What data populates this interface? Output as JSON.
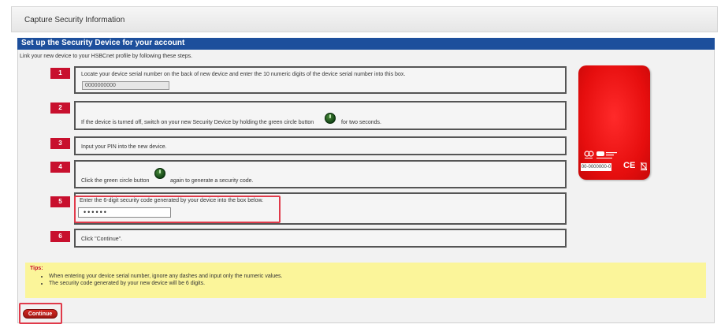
{
  "page": {
    "header_title": "Capture Security Information"
  },
  "section": {
    "title": "Set up the Security Device for your account",
    "intro": "Link your new device to your HSBCnet profile by following these steps."
  },
  "steps": [
    {
      "number": "1",
      "text": "Locate your device serial number on the back of new device and enter the 10 numeric digits of the device serial number into this box.",
      "input_value": "0000000000"
    },
    {
      "number": "2",
      "text_before": "If the device is turned off, switch on your new Security Device by holding the green circle button",
      "text_after": "for two seconds."
    },
    {
      "number": "3",
      "text": "Input your PIN into the new device."
    },
    {
      "number": "4",
      "text_before": "Click the green circle button",
      "text_after": "again to generate a security code."
    },
    {
      "number": "5",
      "text": "Enter the 6-digit security code generated by your device into the box below.",
      "input_value": "••••••"
    },
    {
      "number": "6",
      "text": "Click \"Continue\"."
    }
  ],
  "device": {
    "serial_label": "00-0000000-0",
    "ce_mark": "CE"
  },
  "tips": {
    "title": "Tips:",
    "items": [
      "When entering your device serial number, ignore any dashes and input only the numeric values.",
      "The security code generated by your new device will be 6 digits."
    ]
  },
  "actions": {
    "continue_label": "Continue"
  },
  "colors": {
    "brand_blue": "#1d4f9c",
    "brand_red": "#c8102e",
    "tips_bg": "#fbf59a",
    "highlight": "#e03a4a"
  }
}
